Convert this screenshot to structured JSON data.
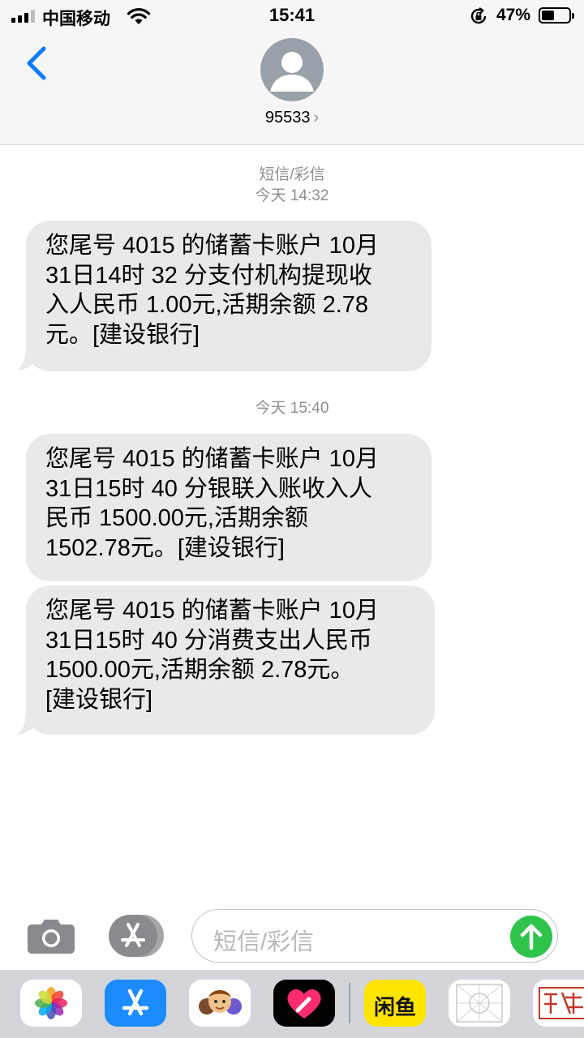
{
  "status_bar": {
    "carrier": "中国移动",
    "time": "15:41",
    "battery_percent_label": "47%",
    "battery_level": 0.47,
    "signal_bars": 3
  },
  "header": {
    "contact": "95533",
    "chevron": "›"
  },
  "thread": {
    "channel_label": "短信/彩信",
    "groups": [
      {
        "timestamp": "今天 14:32",
        "messages": [
          {
            "lines": [
              "您尾号 4015 的储蓄卡账户 10月",
              "31日14时 32 分支付机构提现收",
              "入人民币 1.00元,活期余额 2.78",
              "元。[建设银行]"
            ]
          }
        ]
      },
      {
        "timestamp": "今天 15:40",
        "messages": [
          {
            "lines": [
              "您尾号 4015 的储蓄卡账户 10月",
              "31日15时 40 分银联入账收入人",
              "民币 1500.00元,活期余额",
              "1502.78元。[建设银行]"
            ]
          },
          {
            "lines": [
              "您尾号 4015 的储蓄卡账户 10月",
              "31日15时 40 分消费支出人民币",
              "1500.00元,活期余额 2.78元。",
              "[建设银行]"
            ]
          }
        ]
      }
    ]
  },
  "composer": {
    "placeholder": "短信/彩信"
  },
  "app_drawer": {
    "apps": [
      {
        "name": "photos-app-icon"
      },
      {
        "name": "app-store-app-icon"
      },
      {
        "name": "memoji-app-icon"
      },
      {
        "name": "digital-touch-app-icon"
      },
      {
        "name": "xianyu-app-icon",
        "label": "闲鱼"
      },
      {
        "name": "grid-stamp-app-icon"
      },
      {
        "name": "seal-stamp-app-icon"
      }
    ]
  },
  "colors": {
    "bubble": "#e9e9eb",
    "accent_blue": "#0a7aff",
    "send_green": "#30c34c",
    "secondary_text": "#8e8e93"
  }
}
